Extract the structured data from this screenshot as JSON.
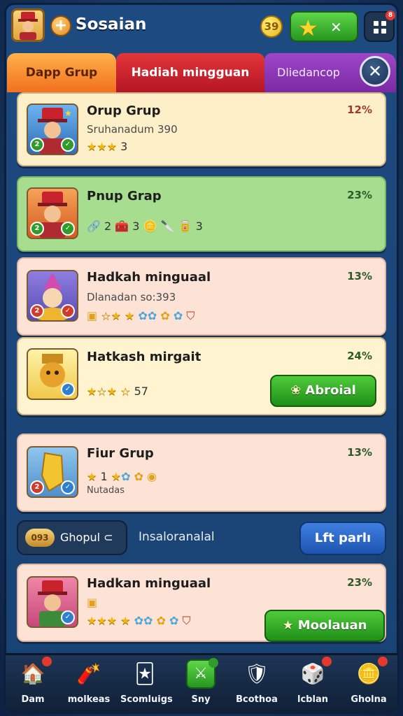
{
  "header": {
    "title": "Sosaian",
    "plus": "+",
    "coin_label": "39",
    "close_x": "✕",
    "notif_count": "8"
  },
  "tabs": [
    {
      "label": "Dapp Grup"
    },
    {
      "label": "Hadiah mingguan"
    },
    {
      "label": "Dliedancop"
    }
  ],
  "close_button": "✕",
  "cards": [
    {
      "title": "Orup Grup",
      "subtitle": "Sruhanadum 390",
      "stars_text": "3",
      "percent": "12%"
    },
    {
      "title": "Pnup Grap",
      "row_text": "🔗 2 🧰 3 🪙 🔪 🥫 3",
      "percent": "23%"
    },
    {
      "title": "Hadkah minguaal",
      "subtitle": "Dlanadan so:393",
      "percent": "13%"
    },
    {
      "title": "Hatkash mirgait",
      "row_text": "57",
      "percent": "24%",
      "button": "Abroial"
    },
    {
      "title": "Fiur Grup",
      "row_text": "1",
      "subtitle": "Nutadas",
      "percent": "13%"
    },
    {
      "title": "Hadkan minguaal",
      "percent": "23%",
      "button": "Moolauan"
    }
  ],
  "filterbar": {
    "coins_label": "093",
    "chip_label": "Ghopul ⊂",
    "center_label": "Insaloranalal",
    "button_label": "Lft parlı"
  },
  "nav": [
    {
      "label": "Dam",
      "icon": "house-icon"
    },
    {
      "label": "molkeas",
      "icon": "scroll-icon"
    },
    {
      "label": "Scomluigs",
      "icon": "card-icon"
    },
    {
      "label": "Sny",
      "icon": "sword-icon"
    },
    {
      "label": "Bcothoa",
      "icon": "shield-icon"
    },
    {
      "label": "lcblan",
      "icon": "dice-icon"
    },
    {
      "label": "Gholna",
      "icon": "coin-icon"
    }
  ],
  "colors": {
    "tab_orange": "#f2701e",
    "tab_red": "#b51624",
    "tab_purple": "#7a2aa3",
    "claim_green": "#26961f",
    "blue_button": "#1e54b1"
  }
}
